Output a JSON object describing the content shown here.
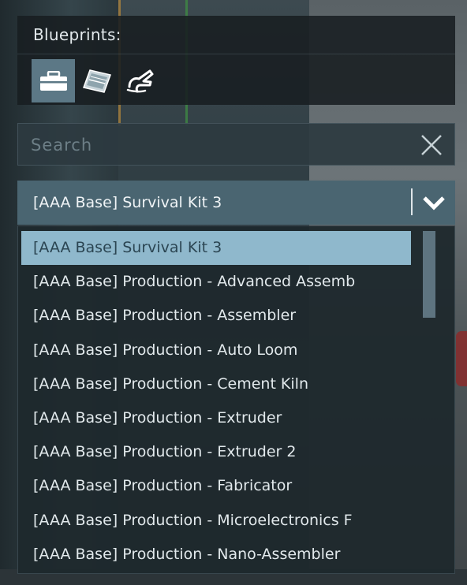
{
  "blueprints_panel": {
    "title": "Blueprints:",
    "tabs": [
      {
        "icon": "toolbox-icon",
        "active": true
      },
      {
        "icon": "blueprint-sheet-icon",
        "active": false
      },
      {
        "icon": "hand-scan-icon",
        "active": false
      }
    ]
  },
  "search": {
    "placeholder": "Search",
    "value": ""
  },
  "combo": {
    "selected": "[AAA Base] Survival Kit 3"
  },
  "dropdown": {
    "items": [
      "[AAA Base] Survival Kit 3",
      "[AAA Base] Production - Advanced Assemb",
      "[AAA Base] Production - Assembler",
      "[AAA Base] Production - Auto Loom",
      "[AAA Base] Production - Cement Kiln",
      "[AAA Base] Production - Extruder",
      "[AAA Base] Production - Extruder 2",
      "[AAA Base] Production - Fabricator",
      "[AAA Base] Production - Microelectronics F",
      "[AAA Base] Production - Nano-Assembler"
    ],
    "selected_index": 0
  },
  "colors": {
    "accent": "#4a6571",
    "selected_row": "#8fb8cc",
    "active_tab": "#5c7886"
  }
}
